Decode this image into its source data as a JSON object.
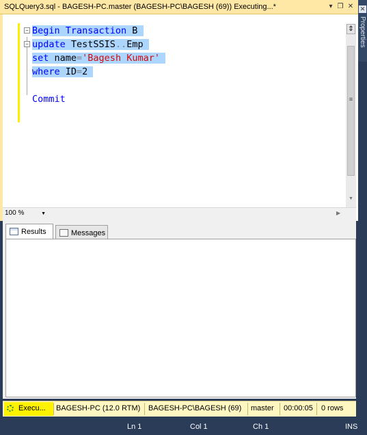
{
  "window": {
    "title": "SQLQuery3.sql - BAGESH-PC.master (BAGESH-PC\\BAGESH (69)) Executing...*",
    "pin_glyph": "▾",
    "restore_glyph": "❐",
    "close_glyph": "✕"
  },
  "side_panel": {
    "label": "Properties",
    "close_glyph": "✕"
  },
  "editor": {
    "lines": [
      {
        "tokens": [
          {
            "t": "Begin Transaction",
            "c": "kw"
          },
          {
            "t": " B",
            "c": "txt"
          }
        ]
      },
      {
        "tokens": [
          {
            "t": "update",
            "c": "kw"
          },
          {
            "t": " TestSSIS",
            "c": "txt"
          },
          {
            "t": "..",
            "c": "op"
          },
          {
            "t": "Emp",
            "c": "txt"
          }
        ]
      },
      {
        "tokens": [
          {
            "t": "set",
            "c": "kw"
          },
          {
            "t": " name",
            "c": "txt"
          },
          {
            "t": "=",
            "c": "op"
          },
          {
            "t": "'Bagesh Kumar'",
            "c": "str"
          }
        ]
      },
      {
        "tokens": [
          {
            "t": "where",
            "c": "kw"
          },
          {
            "t": " ID",
            "c": "txt"
          },
          {
            "t": "=",
            "c": "op"
          },
          {
            "t": "2",
            "c": "txt"
          }
        ]
      },
      {
        "tokens": []
      },
      {
        "tokens": [
          {
            "t": "Commit",
            "c": "kw"
          }
        ]
      }
    ],
    "fold_glyph": "−",
    "zoom": "100 %"
  },
  "results_tabs": [
    {
      "label": "Results"
    },
    {
      "label": "Messages"
    }
  ],
  "query_status": {
    "state": "Execu...",
    "server": "BAGESH-PC (12.0 RTM)",
    "user": "BAGESH-PC\\BAGESH (69)",
    "database": "master",
    "elapsed": "00:00:05",
    "rows": "0 rows"
  },
  "status_bar": {
    "line": "Ln 1",
    "col": "Col 1",
    "ch": "Ch 1",
    "mode": "INS"
  },
  "colors": {
    "keyword": "#0000ff",
    "string": "#d20a0a",
    "selection": "#add6ff",
    "title_bar": "#ffe8a6",
    "status_bar": "#2b3c59"
  }
}
